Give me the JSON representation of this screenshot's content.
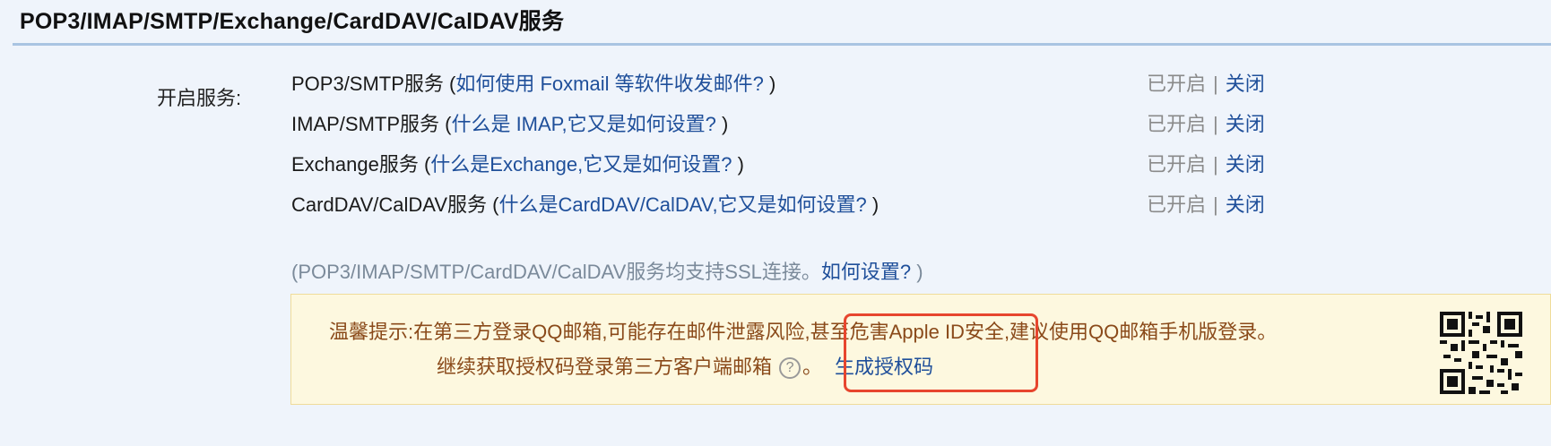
{
  "section_title": "POP3/IMAP/SMTP/Exchange/CardDAV/CalDAV服务",
  "enable_label": "开启服务:",
  "services": [
    {
      "name": "POP3/SMTP服务 (",
      "link": "如何使用 Foxmail 等软件收发邮件?",
      "close_paren": " )",
      "status_on": "已开启",
      "separator": "|",
      "status_off": "关闭"
    },
    {
      "name": "IMAP/SMTP服务 (",
      "link": "什么是 IMAP,它又是如何设置?",
      "close_paren": " )",
      "status_on": "已开启",
      "separator": "|",
      "status_off": "关闭"
    },
    {
      "name": "Exchange服务 (",
      "link": "什么是Exchange,它又是如何设置?",
      "close_paren": " )",
      "status_on": "已开启",
      "separator": "|",
      "status_off": "关闭"
    },
    {
      "name": "CardDAV/CalDAV服务 (",
      "link": "什么是CardDAV/CalDAV,它又是如何设置?",
      "close_paren": " )",
      "status_on": "已开启",
      "separator": "|",
      "status_off": "关闭"
    }
  ],
  "ssl_note": {
    "prefix": "(POP3/IMAP/SMTP/CardDAV/CalDAV服务均支持SSL连接。",
    "link": "如何设置?",
    "suffix": " )"
  },
  "notice": {
    "line1": "温馨提示:在第三方登录QQ邮箱,可能存在邮件泄露风险,甚至危害Apple ID安全,建议使用QQ邮箱手机版登录。",
    "line2": "继续获取授权码登录第三方客户端邮箱",
    "help_glyph": "?",
    "period": "。",
    "generate_link": "生成授权码"
  },
  "colors": {
    "background": "#eff4fb",
    "link": "#1f4f9a",
    "notice_bg": "#fdf8df",
    "notice_text": "#8a4a1a",
    "highlight": "#e7462e"
  },
  "icons": {
    "help": "question-circle-icon",
    "qr": "qr-code-icon"
  }
}
